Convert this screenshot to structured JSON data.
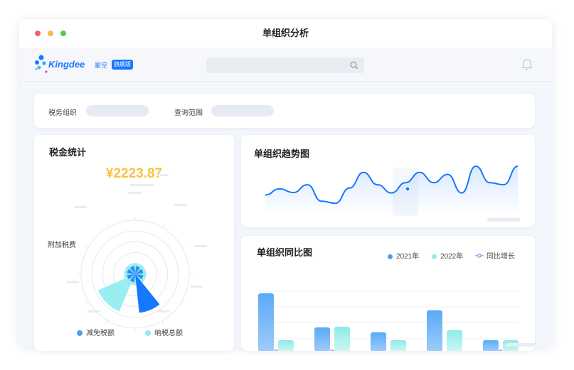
{
  "window": {
    "title": "单组织分析"
  },
  "app": {
    "logo_name": "Kingdee",
    "product": "星空",
    "edition": "旗舰版"
  },
  "search": {
    "placeholder": ""
  },
  "filters": [
    {
      "label": "税务组织",
      "value": ""
    },
    {
      "label": "查询范围",
      "value": ""
    }
  ],
  "tax_card": {
    "title": "税金统计",
    "amount": "¥2223.87",
    "side_label": "附加税费",
    "legend": [
      {
        "label": "减免税额",
        "color": "#4a9ff5"
      },
      {
        "label": "纳税总额",
        "color": "#95ecef"
      }
    ]
  },
  "trend_card": {
    "title": "单组织趋势图"
  },
  "compare_card": {
    "title": "单组织同比图",
    "legend": [
      {
        "label": "2021年",
        "color": "#4a9ff5"
      },
      {
        "label": "2022年",
        "color": "#95ecef"
      },
      {
        "label": "同比增长",
        "color": "#7b6cf0"
      }
    ]
  },
  "colors": {
    "accent": "#1677ff",
    "amount": "#f7c23e",
    "series_2021": "#4a9ff5",
    "series_2022": "#95ecef",
    "growth": "#7b6cf0"
  },
  "chart_data": [
    {
      "type": "pie",
      "variant": "rose",
      "categories": [
        "",
        "",
        "",
        "",
        "",
        "",
        "",
        ""
      ],
      "series": [
        {
          "values": [
            0.15,
            0.15,
            0.72,
            0.15,
            0.15,
            0.15,
            0.15,
            0.15
          ]
        },
        {
          "values": [
            0.2,
            0.2,
            0.2,
            0.2,
            0.75,
            0.2,
            0.2,
            0.2
          ]
        }
      ],
      "grid": true
    },
    {
      "type": "area",
      "x": [
        0,
        1,
        2,
        3,
        4,
        5,
        6,
        7,
        8,
        9,
        10,
        11,
        12,
        13,
        14,
        15,
        16,
        17,
        18
      ],
      "values": [
        0.3,
        0.45,
        0.36,
        0.55,
        0.15,
        0.1,
        0.47,
        0.85,
        0.55,
        0.35,
        0.6,
        0.85,
        0.6,
        0.8,
        0.35,
        1.0,
        0.6,
        0.55,
        1.0
      ],
      "grid": false
    },
    {
      "type": "bar",
      "categories": [
        "",
        "",
        "",
        "",
        ""
      ],
      "series": [
        {
          "name": "2021年",
          "values": [
            82,
            34,
            27,
            58,
            16
          ]
        },
        {
          "name": "2022年",
          "values": [
            16,
            35,
            16,
            30,
            16
          ]
        },
        {
          "name": "同比增长",
          "values": [
            0,
            0,
            -6,
            -9,
            0
          ]
        }
      ],
      "grid": true
    }
  ]
}
